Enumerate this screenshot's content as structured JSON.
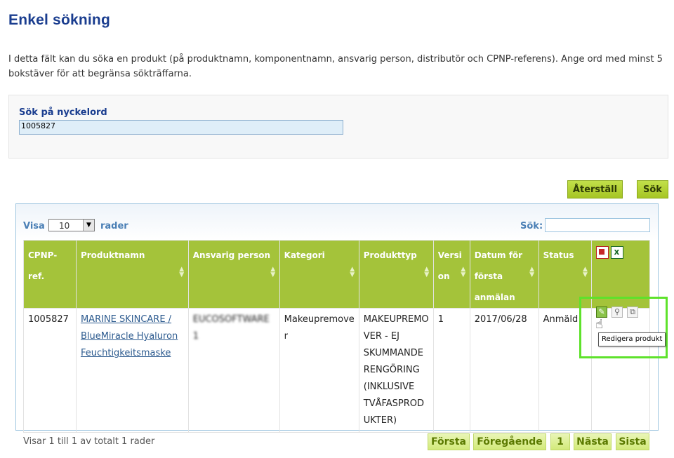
{
  "page": {
    "title": "Enkel sökning",
    "intro": "I detta fält kan du söka en produkt (på produktnamn, komponentnamn, ansvarig person, distributör och CPNP-referens). Ange ord med minst 5 bokstäver för att begränsa sökträffarna."
  },
  "search": {
    "label": "Sök på nyckelord",
    "value": "1005827",
    "reset_label": "Återställ",
    "search_label": "Sök"
  },
  "table_controls": {
    "show_label": "Visa",
    "rows_value": "10",
    "rows_label": "rader",
    "filter_label": "Sök:"
  },
  "columns": {
    "cpnp": "CPNP-ref.",
    "product_name": "Produktnamn",
    "responsible": "Ansvarig person",
    "category": "Kategori",
    "product_type": "Produkttyp",
    "version_a": "Versi",
    "version_b": "on",
    "date_a": "Datum för",
    "date_b": "första",
    "date_c": "anmälan",
    "status": "Status"
  },
  "rows": [
    {
      "cpnp": "1005827",
      "product_name_1": "MARINE SKINCARE /",
      "product_name_2": "BlueMiracle Hyaluron",
      "product_name_3": "Feuchtigkeitsmaske",
      "responsible_1": "EUCOSOFTWARE",
      "responsible_2": "1",
      "category_1": "Makeupremove",
      "category_2": "r",
      "type_1": "MAKEUPREMO",
      "type_2": "VER - EJ",
      "type_3": "SKUMMANDE",
      "type_4": "RENGÖRING",
      "type_5": "(INKLUSIVE",
      "type_6": "TVÅFASPROD",
      "type_7": "UKTER)",
      "version": "1",
      "date": "2017/06/28",
      "status": "Anmäld"
    }
  ],
  "tooltip": "Redigera produkt",
  "footer": {
    "summary": "Visar 1 till 1 av totalt 1 rader",
    "first": "Första",
    "previous": "Föregående",
    "page": "1",
    "next": "Nästa",
    "last": "Sista"
  },
  "icons": {
    "export_pdf": "pdf-icon",
    "export_excel": "excel-icon",
    "edit": "pencil-icon",
    "view": "magnifier-icon",
    "copy": "copy-icon"
  },
  "colors": {
    "title": "#1a3d8f",
    "header_green": "#a4c33a",
    "highlight": "#5ee22b"
  }
}
